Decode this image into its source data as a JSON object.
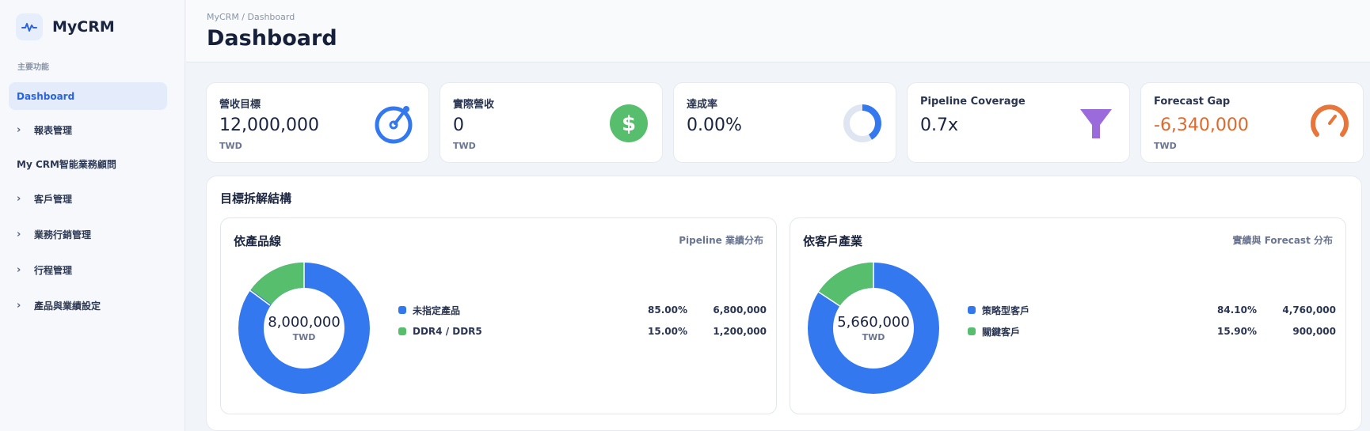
{
  "app": {
    "name": "MyCRM"
  },
  "sidebar": {
    "section_label": "主要功能",
    "items": [
      {
        "label": "Dashboard",
        "active": true,
        "chevron": false
      },
      {
        "label": "報表管理",
        "active": false,
        "chevron": true
      },
      {
        "label": "My CRM智能業務顧問",
        "active": false,
        "chevron": false
      },
      {
        "label": "客戶管理",
        "active": false,
        "chevron": true
      },
      {
        "label": "業務行銷管理",
        "active": false,
        "chevron": true
      },
      {
        "label": "行程管理",
        "active": false,
        "chevron": true
      },
      {
        "label": "產品與業績設定",
        "active": false,
        "chevron": true
      }
    ]
  },
  "header": {
    "breadcrumb": "MyCRM / Dashboard",
    "title": "Dashboard"
  },
  "kpis": [
    {
      "label": "營收目標",
      "value": "12,000,000",
      "unit": "TWD",
      "icon": "target-icon"
    },
    {
      "label": "實際營收",
      "value": "0",
      "unit": "TWD",
      "icon": "dollar-icon"
    },
    {
      "label": "達成率",
      "value": "0.00%",
      "unit": "",
      "icon": "progress-donut-icon"
    },
    {
      "label": "Pipeline Coverage",
      "value": "0.7x",
      "unit": "",
      "icon": "funnel-icon"
    },
    {
      "label": "Forecast Gap",
      "value": "-6,340,000",
      "unit": "TWD",
      "icon": "gauge-icon",
      "negative": true
    }
  ],
  "breakdown": {
    "title": "目標拆解結構",
    "cards": [
      {
        "title": "依產品線",
        "subtitle": "Pipeline 業績分布",
        "total": "8,000,000",
        "unit": "TWD",
        "items": [
          {
            "name": "未指定產品",
            "pct": "85.00%",
            "amount": "6,800,000",
            "color": "#3478f0"
          },
          {
            "name": "DDR4 / DDR5",
            "pct": "15.00%",
            "amount": "1,200,000",
            "color": "#57be6e"
          }
        ]
      },
      {
        "title": "依客戶產業",
        "subtitle": "實績與 Forecast 分布",
        "total": "5,660,000",
        "unit": "TWD",
        "items": [
          {
            "name": "策略型客戶",
            "pct": "84.10%",
            "amount": "4,760,000",
            "color": "#3478f0"
          },
          {
            "name": "關鍵客戶",
            "pct": "15.90%",
            "amount": "900,000",
            "color": "#57be6e"
          }
        ]
      }
    ]
  },
  "colors": {
    "accent": "#3478f0",
    "green": "#57be6e",
    "orange": "#e8763a",
    "purple": "#9b6bdc"
  }
}
